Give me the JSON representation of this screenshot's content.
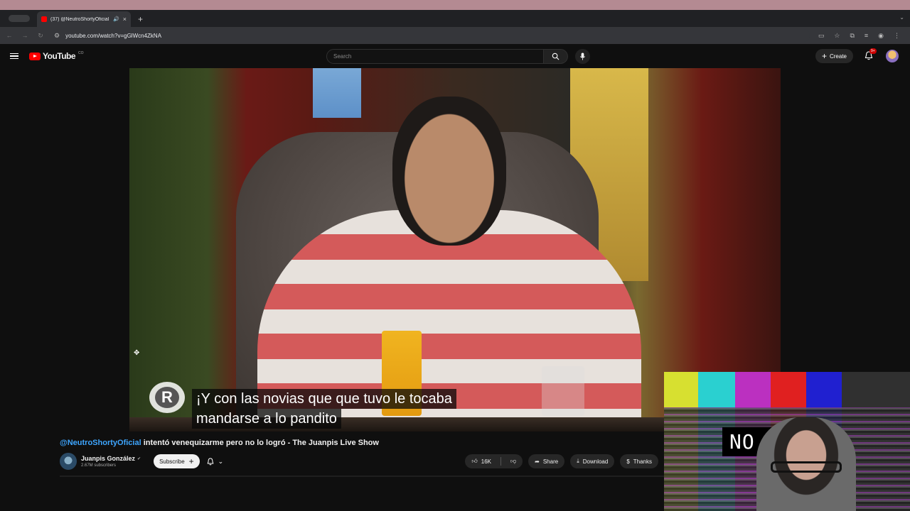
{
  "browser": {
    "tab": {
      "title": "(37) @NeutroShortyOficial",
      "close": "×"
    },
    "new_tab": "+",
    "url": "youtube.com/watch?v=gGlWcn4ZkNA"
  },
  "youtube": {
    "logo_text": "YouTube",
    "logo_country": "CO",
    "search_placeholder": "Search",
    "create_label": "Create",
    "notification_count": "9+"
  },
  "video": {
    "subtitle_lines": [
      "¡Y con las novias que que tuvo le tocaba",
      "mandarse a lo pandito"
    ],
    "title_mention": "@NeutroShortyOficial",
    "title_rest": " intentó venequizarme pero no lo logró - The Juanpis Live Show"
  },
  "channel": {
    "name": "Juanpis González",
    "subscribers": "2.67M subscribers",
    "subscribe_label": "Subscribe"
  },
  "actions": {
    "likes": "16K",
    "share": "Share",
    "download": "Download",
    "thanks": "Thanks"
  },
  "overlay": {
    "no_signal_text": "NO SIG"
  },
  "colors": {
    "yt_red": "#ff0000",
    "mention_blue": "#3ea6ff",
    "background": "#0f0f0f"
  }
}
